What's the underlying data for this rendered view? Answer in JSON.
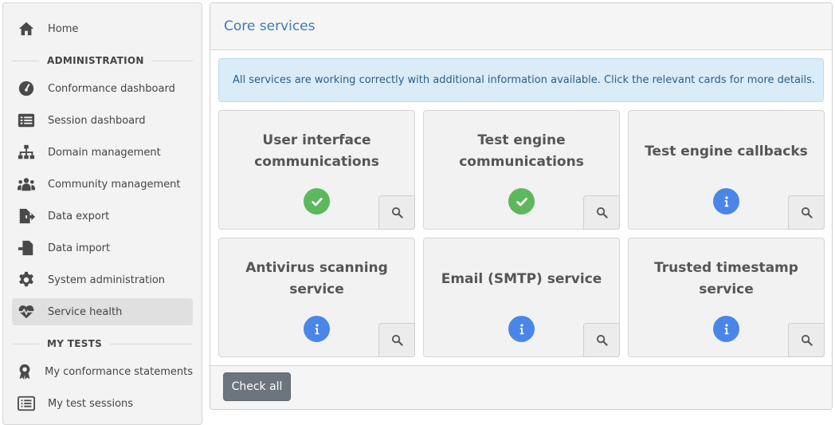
{
  "sidebar": {
    "home": "Home",
    "admin_section": "ADMINISTRATION",
    "admin_items": [
      "Conformance dashboard",
      "Session dashboard",
      "Domain management",
      "Community management",
      "Data export",
      "Data import",
      "System administration",
      "Service health"
    ],
    "mytests_section": "MY TESTS",
    "mytests_items": [
      "My conformance statements",
      "My test sessions"
    ],
    "active_item": "Service health"
  },
  "main": {
    "title": "Core services",
    "alert": "All services are working correctly with additional information available. Click the relevant cards for more details.",
    "cards": [
      {
        "title": "User interface communications",
        "status": "ok"
      },
      {
        "title": "Test engine communications",
        "status": "ok"
      },
      {
        "title": "Test engine callbacks",
        "status": "info"
      },
      {
        "title": "Antivirus scanning service",
        "status": "info"
      },
      {
        "title": "Email (SMTP) service",
        "status": "info"
      },
      {
        "title": "Trusted timestamp service",
        "status": "info"
      }
    ],
    "check_all": "Check all"
  },
  "colors": {
    "accent": "#3d7ab8",
    "ok": "#5cb85c",
    "info": "#4a86e8",
    "alert_bg": "#d9ecf8",
    "button": "#6c757d"
  }
}
